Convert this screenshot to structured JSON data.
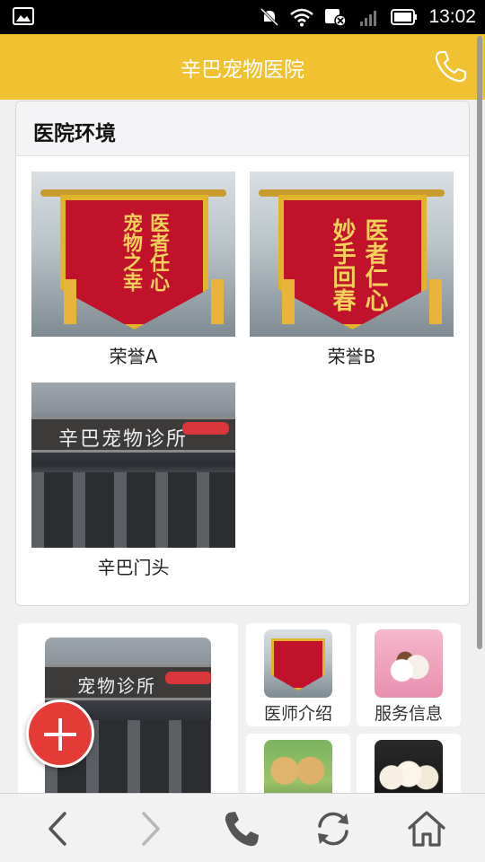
{
  "status_bar": {
    "time": "13:02",
    "icons": [
      "image-icon",
      "mute-icon",
      "wifi-icon",
      "data-icon",
      "signal-icon",
      "battery-icon"
    ]
  },
  "header": {
    "title": "辛巴宠物医院",
    "phone_icon": "phone-icon"
  },
  "environment_card": {
    "title": "医院环境",
    "items": [
      {
        "caption": "荣誉A",
        "pennant_lines": [
          "医者任心",
          "宠物之幸"
        ]
      },
      {
        "caption": "荣誉B",
        "pennant_lines": [
          "医者仁心",
          "妙手回春"
        ]
      },
      {
        "caption": "辛巴门头",
        "sign_text": "辛巴宠物诊所"
      }
    ]
  },
  "grid": {
    "big_sign_text": "宠物诊所",
    "cells": [
      {
        "label": "医师介绍"
      },
      {
        "label": "服务信息"
      }
    ]
  },
  "fab": {
    "icon": "plus-icon"
  },
  "nav": {
    "buttons": [
      "back-icon",
      "forward-icon",
      "phone-icon",
      "refresh-icon",
      "home-icon"
    ]
  },
  "colors": {
    "header": "#f0c232",
    "fab": "#e53b36",
    "pennant": "#c0122a"
  }
}
